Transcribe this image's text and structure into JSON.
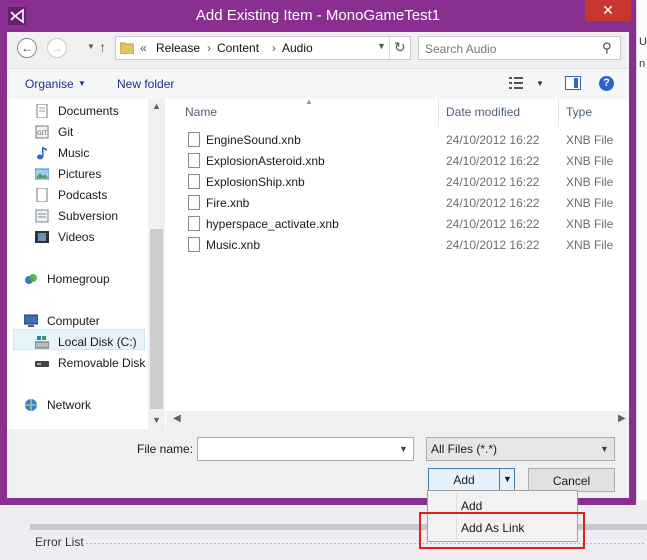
{
  "window": {
    "title": "Add Existing Item - MonoGameTest1",
    "close_glyph": "✕"
  },
  "address": {
    "overflow": "«",
    "crumbs": [
      "Release",
      "Content",
      "Audio"
    ],
    "search_placeholder": "Search Audio"
  },
  "toolbar": {
    "organise": "Organise",
    "new_folder": "New folder"
  },
  "navpane": {
    "items": [
      "Documents",
      "Git",
      "Music",
      "Pictures",
      "Podcasts",
      "Subversion",
      "Videos"
    ],
    "homegroup": "Homegroup",
    "computer": "Computer",
    "computer_items": [
      "Local Disk (C:)",
      "Removable Disk ("
    ],
    "network": "Network"
  },
  "filelist": {
    "headers": {
      "name": "Name",
      "date": "Date modified",
      "type": "Type"
    },
    "rows": [
      {
        "name": "EngineSound.xnb",
        "date": "24/10/2012 16:22",
        "type": "XNB File"
      },
      {
        "name": "ExplosionAsteroid.xnb",
        "date": "24/10/2012 16:22",
        "type": "XNB File"
      },
      {
        "name": "ExplosionShip.xnb",
        "date": "24/10/2012 16:22",
        "type": "XNB File"
      },
      {
        "name": "Fire.xnb",
        "date": "24/10/2012 16:22",
        "type": "XNB File"
      },
      {
        "name": "hyperspace_activate.xnb",
        "date": "24/10/2012 16:22",
        "type": "XNB File"
      },
      {
        "name": "Music.xnb",
        "date": "24/10/2012 16:22",
        "type": "XNB File"
      }
    ]
  },
  "bottom": {
    "file_name_label": "File name:",
    "file_name_value": "",
    "filter": "All Files (*.*)",
    "add": "Add",
    "cancel": "Cancel"
  },
  "menu": {
    "items": [
      "Add",
      "Add As Link"
    ]
  },
  "ide": {
    "error_list": "Error List",
    "right_chars": [
      "U",
      "n"
    ]
  },
  "colors": {
    "titlebar": "#8a2e8f",
    "close": "#c7372f",
    "highlight": "#e0201a",
    "link_text": "#1e3287"
  }
}
